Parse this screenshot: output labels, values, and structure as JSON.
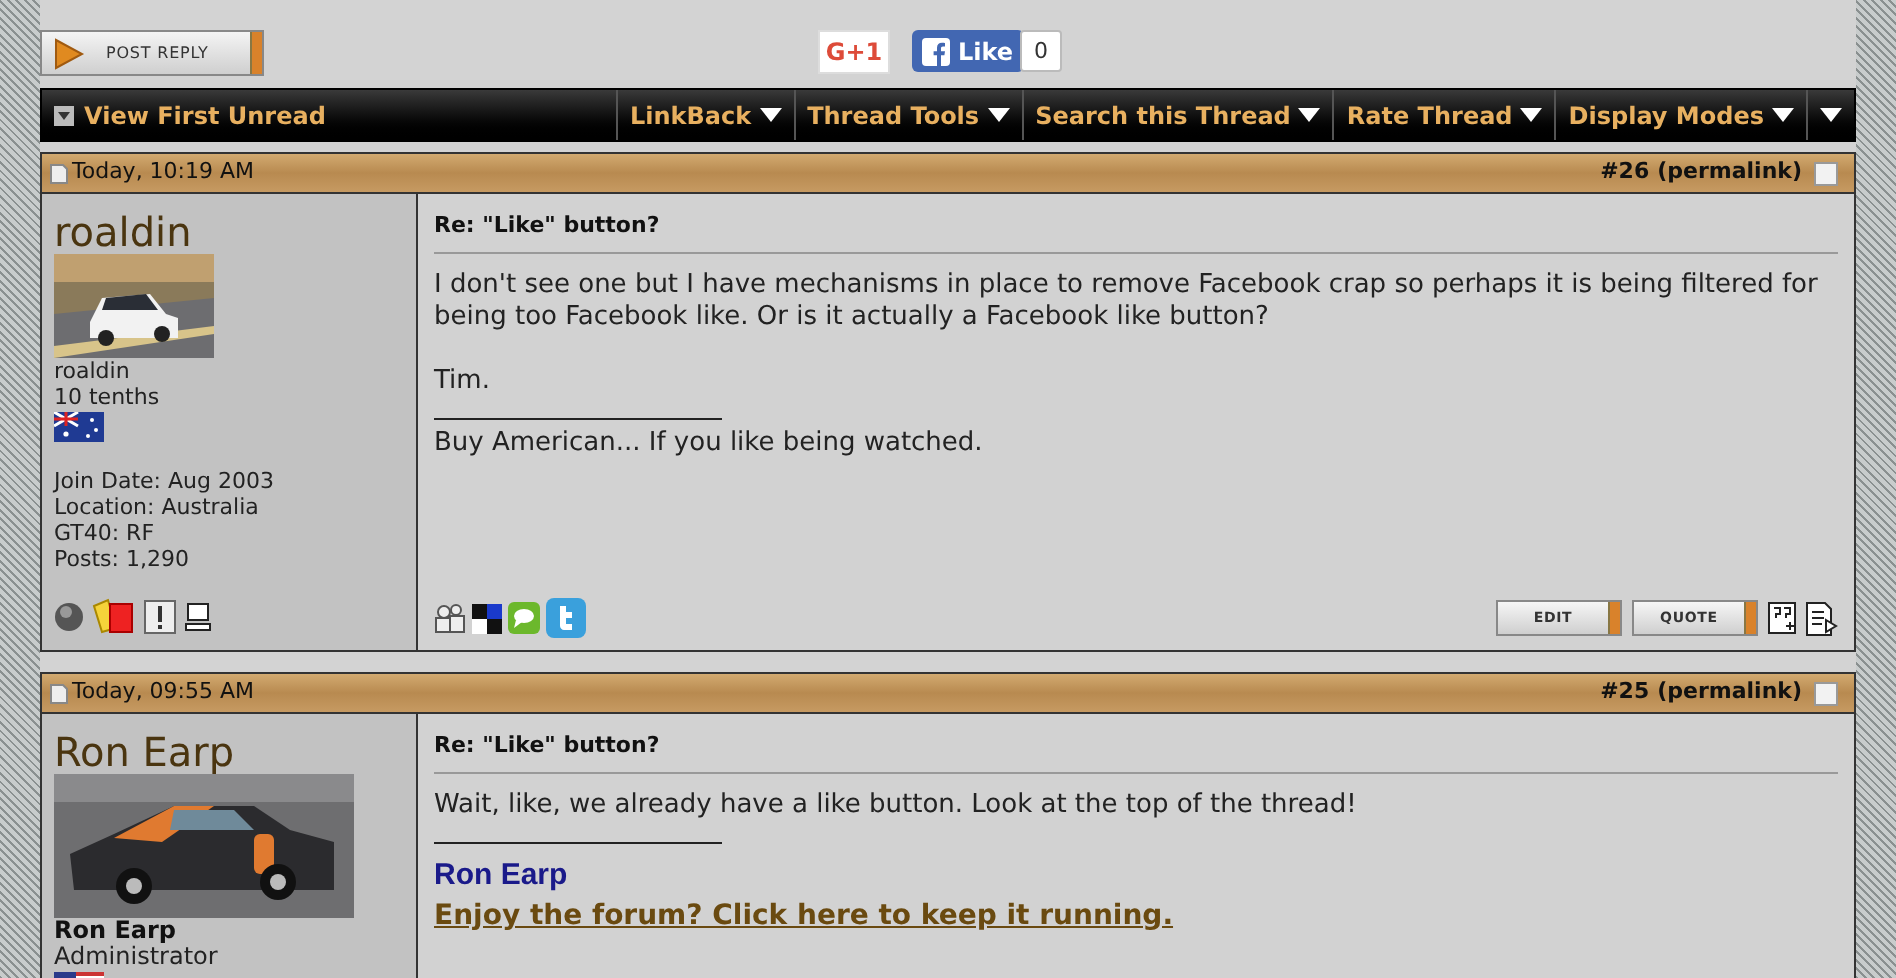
{
  "toolbar": {
    "post_reply": "POST REPLY",
    "gplus": "G+1",
    "fb_like": "Like",
    "fb_count": "0"
  },
  "navbar": {
    "first": "View First Unread",
    "menus": [
      "LinkBack",
      "Thread Tools",
      "Search this Thread",
      "Rate Thread",
      "Display Modes"
    ]
  },
  "posts": [
    {
      "date": "Today, 10:19 AM",
      "number": "#26",
      "permalink": "(permalink)",
      "checked": false,
      "username": "roaldin",
      "avatar": {
        "kind": "picture"
      },
      "display_name": "roaldin",
      "name_bold": false,
      "title": "10 tenths",
      "flag": {
        "kind": "australia"
      },
      "info": [
        "Join Date: Aug 2003",
        "Location: Australia",
        "GT40: RF",
        "Posts: 1,290"
      ],
      "user_icons": [
        {
          "kind": "status"
        },
        {
          "kind": "cards"
        },
        {
          "kind": "report"
        },
        {
          "kind": "computer"
        }
      ],
      "subject": "Re: \"Like\" button?",
      "body": [
        "I don't see one but I have mechanisms in place to remove Facebook crap so perhaps it is being filtered for being too Facebook like. Or is it actually a Facebook like button?",
        "Tim."
      ],
      "signature": [
        {
          "kind": "plain",
          "text": "Buy American... If you like being watched."
        }
      ],
      "buttons": [
        "EDIT",
        "QUOTE"
      ]
    },
    {
      "date": "Today, 09:55 AM",
      "number": "#25",
      "permalink": "(permalink)",
      "checked": false,
      "username": "Ron Earp",
      "avatar": {
        "kind": "picture"
      },
      "display_name": "Ron Earp",
      "name_bold": true,
      "title": "Administrator",
      "flag": {
        "kind": "usa"
      },
      "subject": "Re: \"Like\" button?",
      "body": [
        "Wait, like, we already have a like button. Look at the top of the thread!"
      ],
      "signature": [
        {
          "kind": "name",
          "text": "Ron Earp"
        },
        {
          "kind": "link",
          "text": "Enjoy the forum? Click here to keep it running."
        }
      ]
    }
  ]
}
